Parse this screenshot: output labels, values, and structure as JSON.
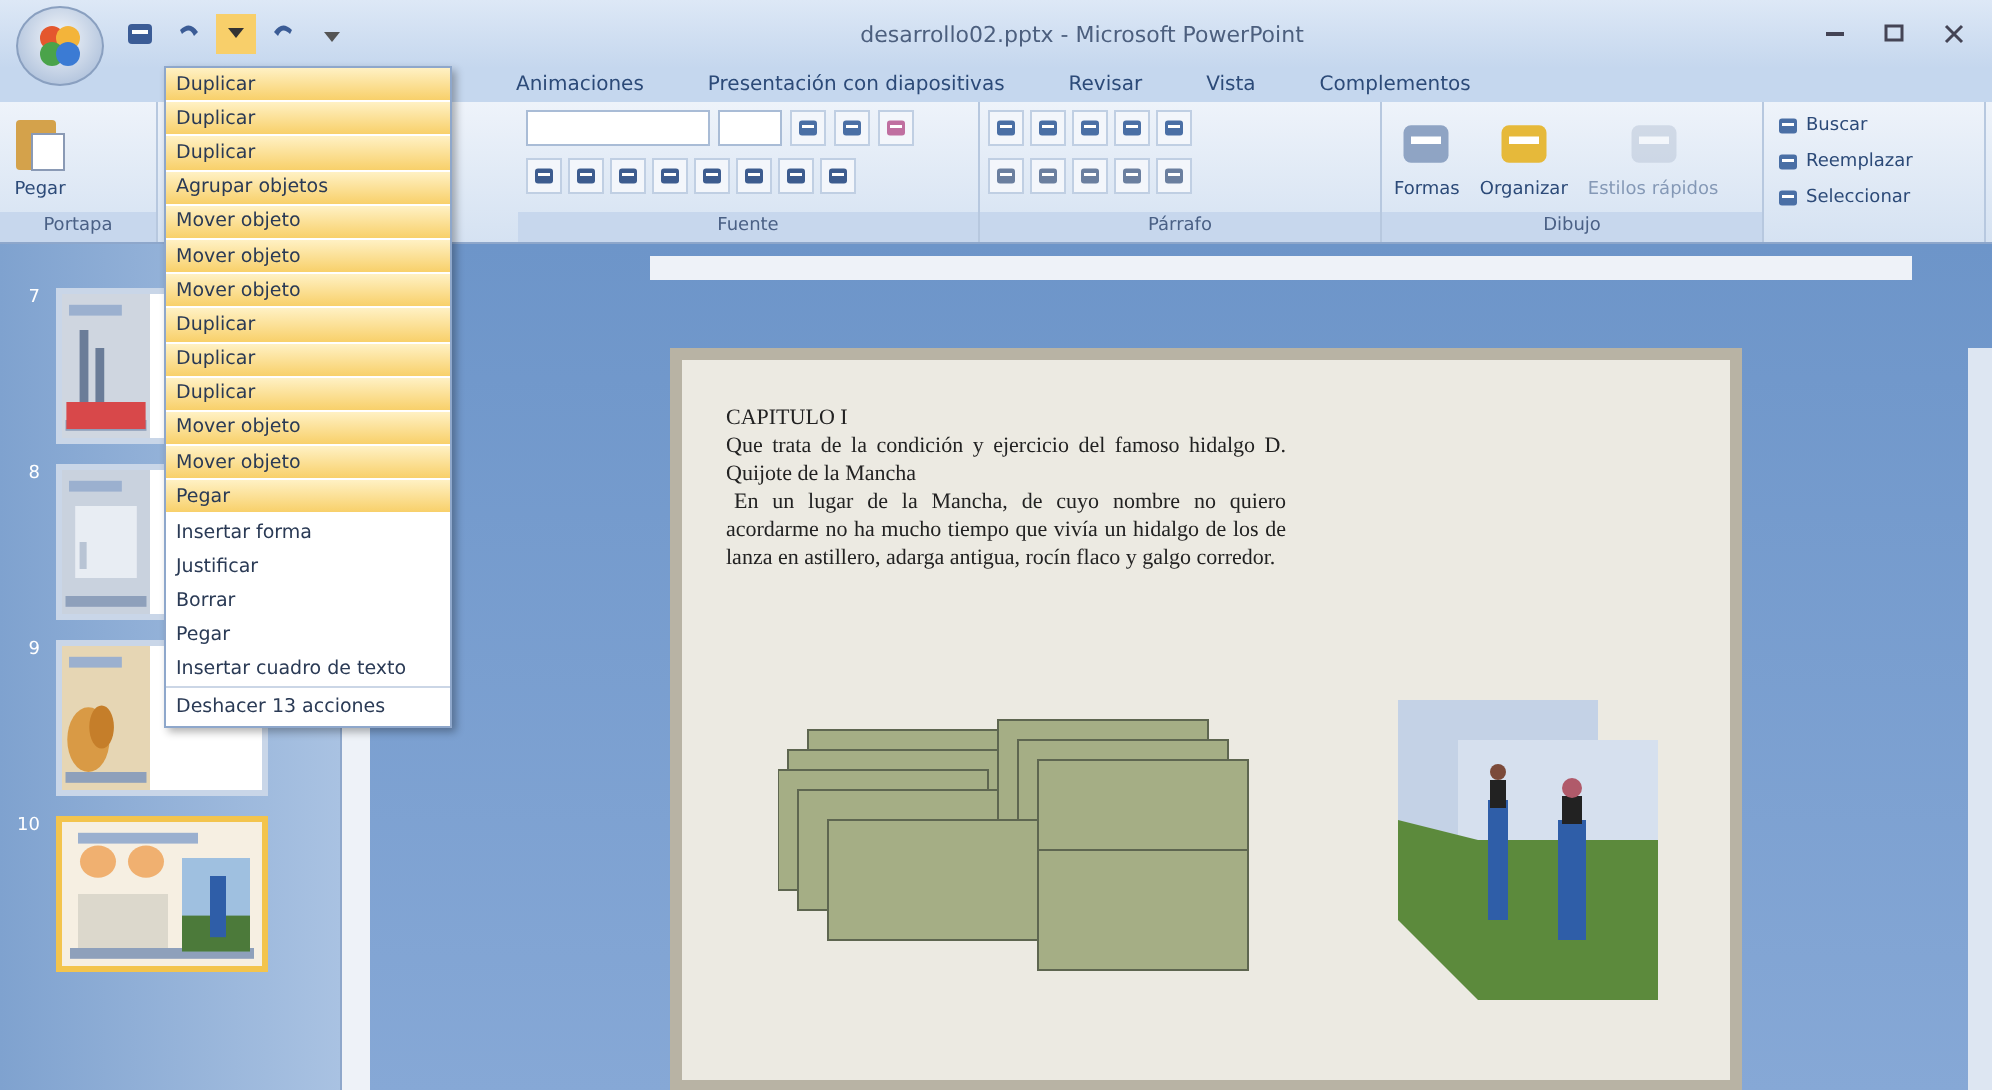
{
  "window": {
    "title": "desarrollo02.pptx - Microsoft PowerPoint"
  },
  "tabs": [
    {
      "label": "Animaciones",
      "selected": false
    },
    {
      "label": "Presentación con diapositivas",
      "selected": false
    },
    {
      "label": "Revisar",
      "selected": false
    },
    {
      "label": "Vista",
      "selected": false
    },
    {
      "label": "Complementos",
      "selected": false
    }
  ],
  "ribbon": {
    "groups": [
      {
        "kind": "clipboard",
        "label": "Portapa",
        "buttons": [
          "Pegar"
        ]
      },
      {
        "kind": "font",
        "label": "Fuente"
      },
      {
        "kind": "paragraph",
        "label": "Párrafo"
      },
      {
        "kind": "drawing",
        "label": "Dibujo",
        "buttons": [
          "Formas",
          "Organizar",
          "Estilos rápidos"
        ]
      },
      {
        "kind": "editing",
        "buttons": [
          "Buscar",
          "Reemplazar",
          "Seleccionar"
        ]
      }
    ]
  },
  "undo_menu": {
    "items": [
      {
        "label": "Duplicar",
        "selected": true
      },
      {
        "label": "Duplicar",
        "selected": true
      },
      {
        "label": "Duplicar",
        "selected": true
      },
      {
        "label": "Agrupar objetos",
        "selected": true
      },
      {
        "label": "Mover objeto",
        "selected": true
      },
      {
        "label": "Mover objeto",
        "selected": true
      },
      {
        "label": "Mover objeto",
        "selected": true
      },
      {
        "label": "Duplicar",
        "selected": true
      },
      {
        "label": "Duplicar",
        "selected": true
      },
      {
        "label": "Duplicar",
        "selected": true
      },
      {
        "label": "Mover objeto",
        "selected": true
      },
      {
        "label": "Mover objeto",
        "selected": true
      },
      {
        "label": "Pegar",
        "selected": true
      },
      {
        "label": "Insertar forma",
        "selected": false
      },
      {
        "label": "Justificar",
        "selected": false
      },
      {
        "label": "Borrar",
        "selected": false
      },
      {
        "label": "Pegar",
        "selected": false
      },
      {
        "label": "Insertar cuadro de texto",
        "selected": false
      }
    ],
    "footer": "Deshacer 13 acciones"
  },
  "slides": [
    {
      "number": "7",
      "selected": false
    },
    {
      "number": "8",
      "selected": false
    },
    {
      "number": "9",
      "selected": false
    },
    {
      "number": "10",
      "selected": true
    }
  ],
  "slide": {
    "heading": "CAPITULO I",
    "subtitle": "Que trata de la condición y ejercicio del famoso hidalgo D. Quijote de la Mancha",
    "body": "En un lugar de la Mancha, de cuyo nombre no quiero acordarme no ha mucho tiempo que vivía un hidalgo de los de lanza en astillero, adarga antigua, rocín flaco y galgo corredor."
  }
}
